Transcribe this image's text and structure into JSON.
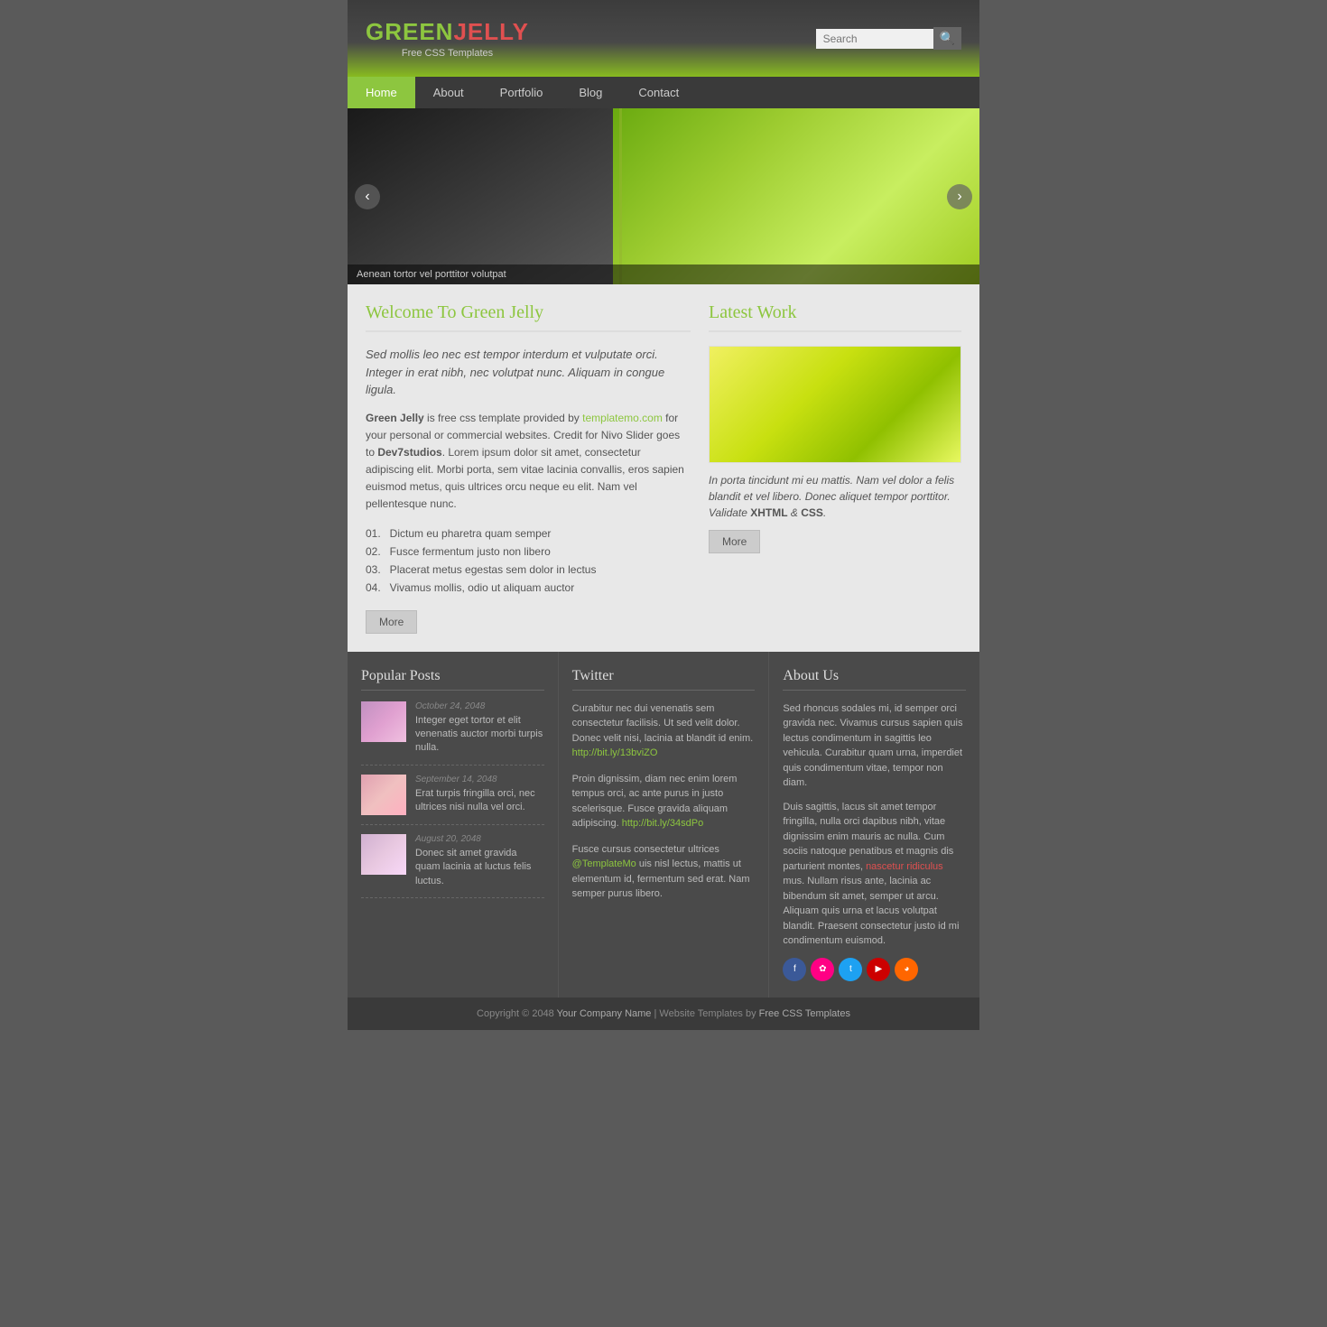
{
  "header": {
    "logo_green": "GREEN",
    "logo_jelly": "JELLY",
    "logo_sub": "Free CSS Templates",
    "search_placeholder": "Search",
    "search_btn": "🔍"
  },
  "nav": {
    "items": [
      {
        "label": "Home",
        "active": true
      },
      {
        "label": "About",
        "active": false
      },
      {
        "label": "Portfolio",
        "active": false
      },
      {
        "label": "Blog",
        "active": false
      },
      {
        "label": "Contact",
        "active": false
      }
    ]
  },
  "slider": {
    "caption": "Aenean tortor vel porttitor volutpat"
  },
  "welcome": {
    "title": "Welcome To Green Jelly",
    "intro": "Sed mollis leo nec est tempor interdum et vulputate orci. Integer in erat nibh, nec volutpat nunc. Aliquam in congue ligula.",
    "body1": "Green Jelly is free css template provided by templatemo.com for your personal or commercial websites. Credit for Nivo Slider goes to Dev7studios. Lorem ipsum dolor sit amet, consectetur adipiscing elit. Morbi porta, sem vitae lacinia convallis, eros sapien euismod metus, quis ultrices orcu neque eu elit. Nam vel pellentesque nunc.",
    "list": [
      "01.   Dictum eu pharetra quam semper",
      "02.   Fusce fermentum justo non libero",
      "03.   Placerat metus egestas sem dolor in lectus",
      "04.   Vivamus mollis, odio ut aliquam auctor"
    ],
    "more_btn": "More"
  },
  "latest_work": {
    "title": "Latest Work",
    "caption": "In porta tincidunt mi eu mattis. Nam vel dolor a felis blandit et vel libero. Donec aliquet tempor porttitor. Validate XHTML & CSS.",
    "more_btn": "More"
  },
  "footer": {
    "popular_posts": {
      "title": "Popular Posts",
      "posts": [
        {
          "date": "October 24, 2048",
          "text": "Integer eget tortor et elit venenatis auctor morbi turpis nulla."
        },
        {
          "date": "September 14, 2048",
          "text": "Erat turpis fringilla orci, nec ultrices nisi nulla vel orci."
        },
        {
          "date": "August 20, 2048",
          "text": "Donec sit amet gravida quam lacinia at luctus felis luctus."
        }
      ]
    },
    "twitter": {
      "title": "Twitter",
      "tweets": [
        {
          "text": "Curabitur nec dui venenatis sem consectetur facilisis. Ut sed velit dolor. Donec velit nisi, lacinia at blandit id enim. http://bit.ly/13bviZO"
        },
        {
          "text": "Proin dignissim, diam nec enim lorem tempus orci, ac ante purus in justo scelerisque. Fusce gravida aliquam adipiscing. http://bit.ly/34sdPo"
        },
        {
          "text": "Fusce cursus consectetur ultrices @TemplateMo uis nisl lectus, mattis ut elementum id, fermentum sed erat. Nam semper purus libero."
        }
      ]
    },
    "about_us": {
      "title": "About Us",
      "text1": "Sed rhoncus sodales mi, id semper orci gravida nec. Vivamus cursus sapien quis lectus condimentum in sagittis leo vehicula. Curabitur quam urna, imperdiet quis condimentum vitae, tempor non diam.",
      "text2": "Duis sagittis, lacus sit amet tempor fringilla, nulla orci dapibus nibh, vitae dignissim enim mauris ac nulla. Cum sociis natoque penatibus et magnis dis parturient montes, nascetur ridiculus mus. Nullam risus ante, lacinia ac bibendum sit amet, semper ut arcu. Aliquam quis urna et lacus volutpat blandit. Praesent consectetur justo id mi condimentum euismod.",
      "link_text": "nascetur ridiculus",
      "social": [
        {
          "name": "facebook",
          "label": "f",
          "class": "si-fb"
        },
        {
          "name": "flickr",
          "label": "✿",
          "class": "si-fl"
        },
        {
          "name": "twitter",
          "label": "t",
          "class": "si-tw"
        },
        {
          "name": "youtube",
          "label": "▶",
          "class": "si-yt"
        },
        {
          "name": "rss",
          "label": "◉",
          "class": "si-rss"
        }
      ]
    }
  },
  "footer_bottom": {
    "text": "Copyright © 2048",
    "company": "Your Company Name",
    "link_text": "Website Templates by",
    "link_label": "Free CSS Templates"
  }
}
